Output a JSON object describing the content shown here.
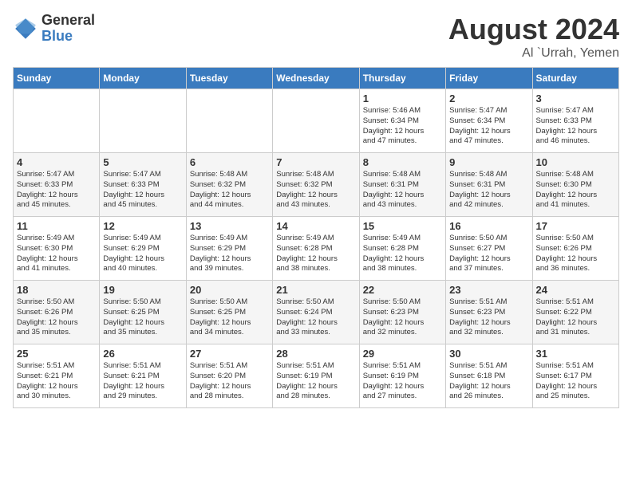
{
  "header": {
    "logo_general": "General",
    "logo_blue": "Blue",
    "month": "August 2024",
    "location": "Al `Urrah, Yemen"
  },
  "days_of_week": [
    "Sunday",
    "Monday",
    "Tuesday",
    "Wednesday",
    "Thursday",
    "Friday",
    "Saturday"
  ],
  "weeks": [
    [
      {
        "day": "",
        "info": ""
      },
      {
        "day": "",
        "info": ""
      },
      {
        "day": "",
        "info": ""
      },
      {
        "day": "",
        "info": ""
      },
      {
        "day": "1",
        "info": "Sunrise: 5:46 AM\nSunset: 6:34 PM\nDaylight: 12 hours\nand 47 minutes."
      },
      {
        "day": "2",
        "info": "Sunrise: 5:47 AM\nSunset: 6:34 PM\nDaylight: 12 hours\nand 47 minutes."
      },
      {
        "day": "3",
        "info": "Sunrise: 5:47 AM\nSunset: 6:33 PM\nDaylight: 12 hours\nand 46 minutes."
      }
    ],
    [
      {
        "day": "4",
        "info": "Sunrise: 5:47 AM\nSunset: 6:33 PM\nDaylight: 12 hours\nand 45 minutes."
      },
      {
        "day": "5",
        "info": "Sunrise: 5:47 AM\nSunset: 6:33 PM\nDaylight: 12 hours\nand 45 minutes."
      },
      {
        "day": "6",
        "info": "Sunrise: 5:48 AM\nSunset: 6:32 PM\nDaylight: 12 hours\nand 44 minutes."
      },
      {
        "day": "7",
        "info": "Sunrise: 5:48 AM\nSunset: 6:32 PM\nDaylight: 12 hours\nand 43 minutes."
      },
      {
        "day": "8",
        "info": "Sunrise: 5:48 AM\nSunset: 6:31 PM\nDaylight: 12 hours\nand 43 minutes."
      },
      {
        "day": "9",
        "info": "Sunrise: 5:48 AM\nSunset: 6:31 PM\nDaylight: 12 hours\nand 42 minutes."
      },
      {
        "day": "10",
        "info": "Sunrise: 5:48 AM\nSunset: 6:30 PM\nDaylight: 12 hours\nand 41 minutes."
      }
    ],
    [
      {
        "day": "11",
        "info": "Sunrise: 5:49 AM\nSunset: 6:30 PM\nDaylight: 12 hours\nand 41 minutes."
      },
      {
        "day": "12",
        "info": "Sunrise: 5:49 AM\nSunset: 6:29 PM\nDaylight: 12 hours\nand 40 minutes."
      },
      {
        "day": "13",
        "info": "Sunrise: 5:49 AM\nSunset: 6:29 PM\nDaylight: 12 hours\nand 39 minutes."
      },
      {
        "day": "14",
        "info": "Sunrise: 5:49 AM\nSunset: 6:28 PM\nDaylight: 12 hours\nand 38 minutes."
      },
      {
        "day": "15",
        "info": "Sunrise: 5:49 AM\nSunset: 6:28 PM\nDaylight: 12 hours\nand 38 minutes."
      },
      {
        "day": "16",
        "info": "Sunrise: 5:50 AM\nSunset: 6:27 PM\nDaylight: 12 hours\nand 37 minutes."
      },
      {
        "day": "17",
        "info": "Sunrise: 5:50 AM\nSunset: 6:26 PM\nDaylight: 12 hours\nand 36 minutes."
      }
    ],
    [
      {
        "day": "18",
        "info": "Sunrise: 5:50 AM\nSunset: 6:26 PM\nDaylight: 12 hours\nand 35 minutes."
      },
      {
        "day": "19",
        "info": "Sunrise: 5:50 AM\nSunset: 6:25 PM\nDaylight: 12 hours\nand 35 minutes."
      },
      {
        "day": "20",
        "info": "Sunrise: 5:50 AM\nSunset: 6:25 PM\nDaylight: 12 hours\nand 34 minutes."
      },
      {
        "day": "21",
        "info": "Sunrise: 5:50 AM\nSunset: 6:24 PM\nDaylight: 12 hours\nand 33 minutes."
      },
      {
        "day": "22",
        "info": "Sunrise: 5:50 AM\nSunset: 6:23 PM\nDaylight: 12 hours\nand 32 minutes."
      },
      {
        "day": "23",
        "info": "Sunrise: 5:51 AM\nSunset: 6:23 PM\nDaylight: 12 hours\nand 32 minutes."
      },
      {
        "day": "24",
        "info": "Sunrise: 5:51 AM\nSunset: 6:22 PM\nDaylight: 12 hours\nand 31 minutes."
      }
    ],
    [
      {
        "day": "25",
        "info": "Sunrise: 5:51 AM\nSunset: 6:21 PM\nDaylight: 12 hours\nand 30 minutes."
      },
      {
        "day": "26",
        "info": "Sunrise: 5:51 AM\nSunset: 6:21 PM\nDaylight: 12 hours\nand 29 minutes."
      },
      {
        "day": "27",
        "info": "Sunrise: 5:51 AM\nSunset: 6:20 PM\nDaylight: 12 hours\nand 28 minutes."
      },
      {
        "day": "28",
        "info": "Sunrise: 5:51 AM\nSunset: 6:19 PM\nDaylight: 12 hours\nand 28 minutes."
      },
      {
        "day": "29",
        "info": "Sunrise: 5:51 AM\nSunset: 6:19 PM\nDaylight: 12 hours\nand 27 minutes."
      },
      {
        "day": "30",
        "info": "Sunrise: 5:51 AM\nSunset: 6:18 PM\nDaylight: 12 hours\nand 26 minutes."
      },
      {
        "day": "31",
        "info": "Sunrise: 5:51 AM\nSunset: 6:17 PM\nDaylight: 12 hours\nand 25 minutes."
      }
    ]
  ]
}
